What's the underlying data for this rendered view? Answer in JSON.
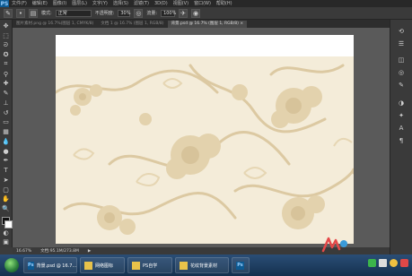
{
  "app": {
    "logo": "PS",
    "menu": [
      "文件(F)",
      "编辑(E)",
      "图像(I)",
      "图层(L)",
      "文字(Y)",
      "选择(S)",
      "滤镜(T)",
      "3D(D)",
      "视图(V)",
      "窗口(W)",
      "帮助(H)"
    ]
  },
  "options": {
    "mode_label": "模式:",
    "mode_value": "正常",
    "opacity_label": "不透明度:",
    "opacity_value": "30%",
    "flow_label": "流量:",
    "flow_value": "100%"
  },
  "tabs": [
    {
      "label": "图片素材.png @ 16.7%(图层 1, CMYK/8)",
      "active": false
    },
    {
      "label": "文档 1 @ 16.7% (图层 1, RGB/8)",
      "active": false
    },
    {
      "label": "背景.psd @ 16.7% (图层 1, RGB/8) ×",
      "active": true
    }
  ],
  "status": {
    "zoom": "16.67%",
    "doc": "文档:95.1M/273.8M"
  },
  "taskbar": {
    "items": [
      {
        "label": "背景.psd @ 16.7...",
        "icon": "photoshop-icon"
      },
      {
        "label": "网络图标",
        "icon": "folder-icon"
      },
      {
        "label": "PS自学",
        "icon": "folder-icon"
      },
      {
        "label": "花纹背景素材",
        "icon": "folder-icon"
      },
      {
        "label": "",
        "icon": "photoshop-icon"
      }
    ]
  },
  "colors": {
    "foreground": "#111111",
    "background": "#ffffff",
    "pattern_base": "#f4ecd9",
    "pattern_ink": "#d9c7a0"
  }
}
